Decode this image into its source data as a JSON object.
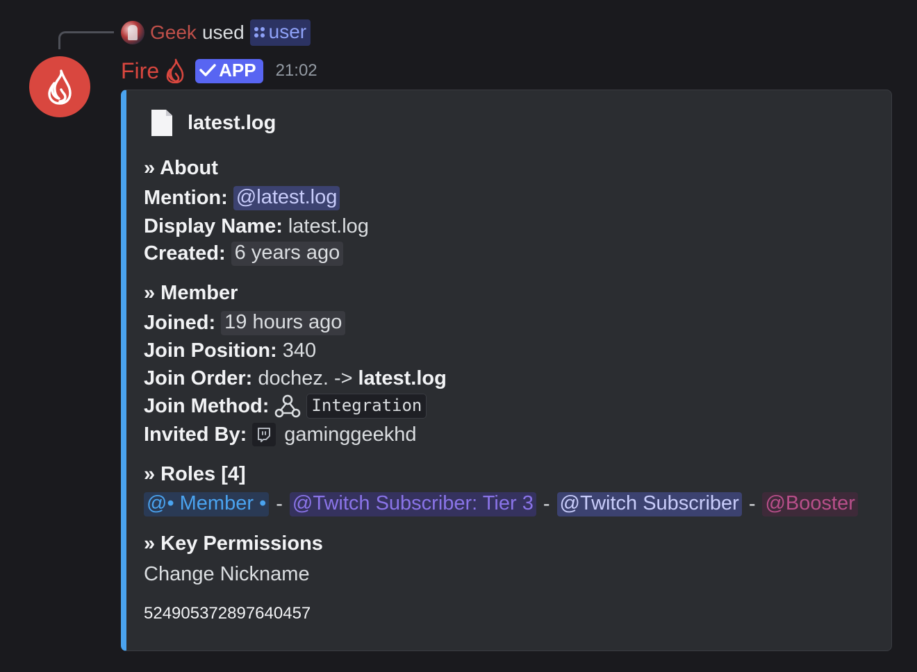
{
  "reply": {
    "user": "Geek",
    "used": "used",
    "command": "user"
  },
  "message": {
    "bot_name": "Fire",
    "app_badge": "APP",
    "timestamp": "21:02"
  },
  "embed": {
    "accent_color": "#4aa3ef",
    "author": "latest.log",
    "about": {
      "title": "» About",
      "mention_label": "Mention:",
      "mention_value": "@latest.log",
      "display_name_label": "Display Name:",
      "display_name_value": "latest.log",
      "created_label": "Created:",
      "created_value": "6 years ago"
    },
    "member": {
      "title": "» Member",
      "joined_label": "Joined:",
      "joined_value": "19 hours ago",
      "join_position_label": "Join Position:",
      "join_position_value": "340",
      "join_order_label": "Join Order:",
      "join_order_prev": "dochez. ->",
      "join_order_current": "latest.log",
      "join_method_label": "Join Method:",
      "join_method_value": "Integration",
      "invited_by_label": "Invited By:",
      "invited_by_value": "gaminggeekhd"
    },
    "roles": {
      "title": "» Roles [4]",
      "items": [
        {
          "label": "@• Member •",
          "color": "#4aa3ef"
        },
        {
          "label": "@Twitch Subscriber: Tier 3",
          "color": "#8a74e8"
        },
        {
          "label": "@Twitch Subscriber",
          "color": "#c9cdfb"
        },
        {
          "label": "@Booster",
          "color": "#b84f8a"
        }
      ],
      "separator": "-"
    },
    "permissions": {
      "title": "» Key Permissions",
      "value": "Change Nickname"
    },
    "footer": "524905372897640457"
  },
  "icons": {
    "reply_avatar": "user-avatar",
    "bot_avatar": "fire-logo-icon",
    "flame": "flame-icon",
    "check": "check-icon",
    "command": "slash-command-icon",
    "file": "file-icon",
    "webhook": "webhook-icon",
    "twitch": "twitch-icon"
  }
}
